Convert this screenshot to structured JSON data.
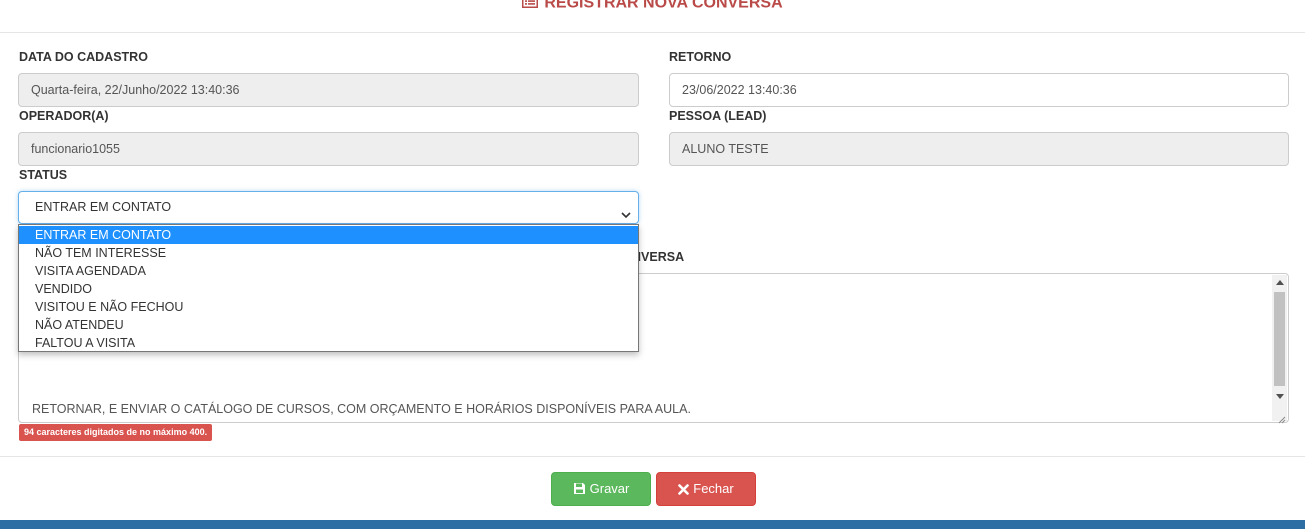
{
  "header": {
    "title": "REGISTRAR NOVA CONVERSA",
    "icon": "list-alt-icon",
    "color": "#b94a48"
  },
  "form": {
    "data_cadastro": {
      "label": "DATA DO CADASTRO",
      "value": "Quarta-feira, 22/Junho/2022 13:40:36"
    },
    "retorno": {
      "label": "RETORNO",
      "value": "23/06/2022 13:40:36"
    },
    "operador": {
      "label": "OPERADOR(A)",
      "value": "funcionario1055"
    },
    "pessoa": {
      "label": "PESSOA (LEAD)",
      "value": "ALUNO TESTE"
    },
    "status": {
      "label": "STATUS",
      "value": "ENTRAR EM CONTATO",
      "options": [
        "ENTRAR EM CONTATO",
        "NÃO TEM INTERESSE",
        "VISITA AGENDADA",
        "VENDIDO",
        "VISITOU E NÃO FECHOU",
        "NÃO ATENDEU",
        "FALTOU A VISITA"
      ]
    },
    "conversa": {
      "label_visible": "NVERSA",
      "text": "RETORNAR, E ENVIAR O CATÁLOGO DE CURSOS, COM ORÇAMENTO E HORÁRIOS DISPONÍVEIS PARA AULA.",
      "counter": "94 caracteres digitados de no máximo 400."
    }
  },
  "buttons": {
    "save": "Gravar",
    "close": "Fechar"
  },
  "colors": {
    "save": "#5cb85c",
    "close": "#d9534f",
    "selected_option": "#1e90ff",
    "bottom_bar": "#2d6ea5"
  }
}
